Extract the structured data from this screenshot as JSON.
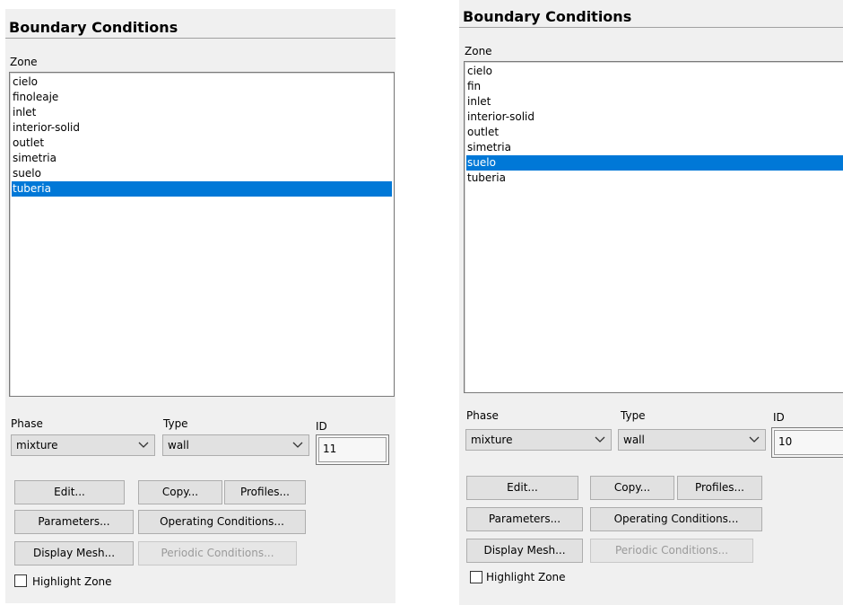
{
  "panels": [
    {
      "title": "Boundary Conditions",
      "zone_label": "Zone",
      "zones": [
        "cielo",
        "finoleaje",
        "inlet",
        "interior-solid",
        "outlet",
        "simetria",
        "suelo",
        "tuberia"
      ],
      "selected_zone": "tuberia",
      "phase_label": "Phase",
      "phase_value": "mixture",
      "type_label": "Type",
      "type_value": "wall",
      "id_label": "ID",
      "id_value": "11",
      "buttons": {
        "edit": "Edit...",
        "copy": "Copy...",
        "profiles": "Profiles...",
        "parameters": "Parameters...",
        "operating_conditions": "Operating Conditions...",
        "display_mesh": "Display Mesh...",
        "periodic_conditions": "Periodic Conditions..."
      },
      "highlight_zone_label": "Highlight Zone",
      "highlight_zone_checked": false
    },
    {
      "title": "Boundary Conditions",
      "zone_label": "Zone",
      "zones": [
        "cielo",
        "fin",
        "inlet",
        "interior-solid",
        "outlet",
        "simetria",
        "suelo",
        "tuberia"
      ],
      "selected_zone": "suelo",
      "phase_label": "Phase",
      "phase_value": "mixture",
      "type_label": "Type",
      "type_value": "wall",
      "id_label": "ID",
      "id_value": "10",
      "buttons": {
        "edit": "Edit...",
        "copy": "Copy...",
        "profiles": "Profiles...",
        "parameters": "Parameters...",
        "operating_conditions": "Operating Conditions...",
        "display_mesh": "Display Mesh...",
        "periodic_conditions": "Periodic Conditions..."
      },
      "highlight_zone_label": "Highlight Zone",
      "highlight_zone_checked": false
    }
  ],
  "colors": {
    "selection": "#0078d7",
    "panel_bg": "#f0f0f0",
    "disabled_text": "#9a9a9a"
  },
  "icons": {
    "dropdown": "chevron-down-icon"
  }
}
